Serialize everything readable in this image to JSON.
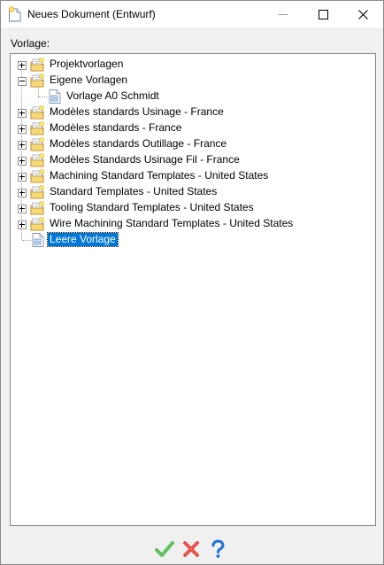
{
  "window": {
    "title": "Neues Dokument (Entwurf)"
  },
  "form": {
    "template_label": "Vorlage:"
  },
  "tree": {
    "items": [
      {
        "label": "Projektvorlagen",
        "type": "folder",
        "expanded": false
      },
      {
        "label": "Eigene Vorlagen",
        "type": "folder",
        "expanded": true,
        "children": [
          {
            "label": "Vorlage A0 Schmidt",
            "type": "document"
          }
        ]
      },
      {
        "label": "Modèles standards Usinage - France",
        "type": "folder",
        "expanded": false
      },
      {
        "label": "Modèles standards - France",
        "type": "folder",
        "expanded": false
      },
      {
        "label": "Modèles standards Outillage - France",
        "type": "folder",
        "expanded": false
      },
      {
        "label": "Modèles Standards Usinage Fil - France",
        "type": "folder",
        "expanded": false
      },
      {
        "label": "Machining Standard Templates - United States",
        "type": "folder",
        "expanded": false
      },
      {
        "label": "Standard Templates - United States",
        "type": "folder",
        "expanded": false
      },
      {
        "label": "Tooling Standard Templates - United States",
        "type": "folder",
        "expanded": false
      },
      {
        "label": "Wire Machining Standard Templates - United States",
        "type": "folder",
        "expanded": false
      },
      {
        "label": "Leere Vorlage",
        "type": "document",
        "selected": true
      }
    ]
  },
  "colors": {
    "selection": "#0078d7",
    "ok": "#3cb043",
    "cancel": "#e0302a",
    "help": "#1e6fd9"
  },
  "icons": {
    "ok": "checkmark-icon",
    "cancel": "x-icon",
    "help": "question-icon"
  }
}
